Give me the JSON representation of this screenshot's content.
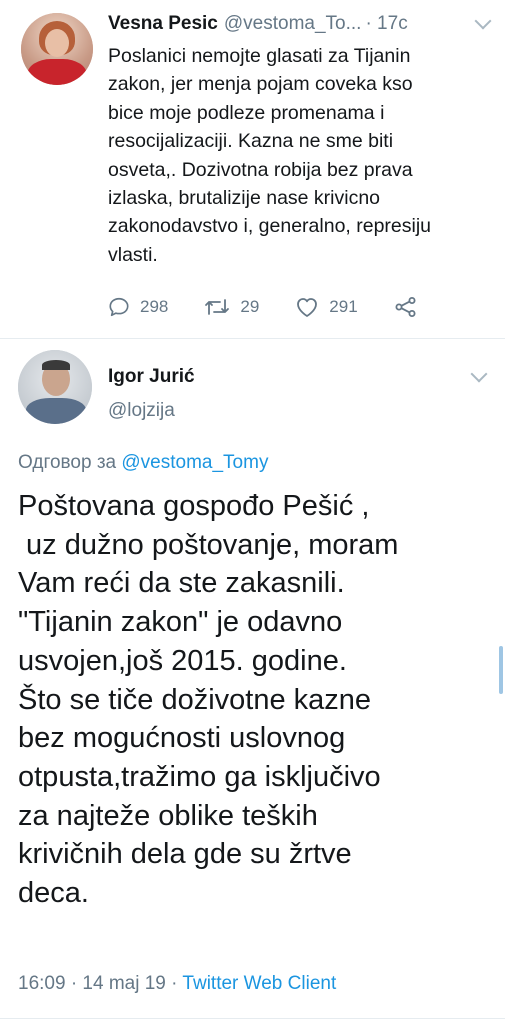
{
  "tweet1": {
    "name": "Vesna Pesic",
    "handle": "@vestoma_To...",
    "time": "· 17c",
    "lines": [
      "Poslanici nemojte glasati za Tijanin",
      "zakon, jer menja pojam coveka kso",
      "bice moje podleze promenama i",
      "resocijalizaciji. Kazna ne sme biti",
      "osveta,. Dozivotna robija bez prava",
      "izlaska, brutalizije nase krivicno",
      "zakonodavstvo i, generalno, represiju",
      "vlasti."
    ],
    "replies": "298",
    "retweets": "29",
    "likes": "291"
  },
  "tweet2": {
    "name": "Igor Jurić",
    "handle": "@lojzija",
    "reply_prefix": "Одговор за",
    "reply_mention": "@vestoma_Tomy",
    "lines": [
      "Poštovana gospođo Pešić ,",
      " uz dužno poštovanje, moram",
      "Vam reći da ste zakasnili.",
      "\"Tijanin zakon\" je odavno",
      "usvojen,još 2015. godine.",
      "Što se tiče doživotne kazne",
      "bez mogućnosti uslovnog",
      "otpusta,tražimo ga isključivo",
      "za najteže oblike teških",
      "krivičnih dela gde su žrtve",
      "deca."
    ],
    "time": "16:09",
    "date": "· 14 maj 19 ·",
    "client": "Twitter Web Client"
  },
  "icons": [
    "reply-icon",
    "retweet-icon",
    "like-icon",
    "share-icon",
    "chevron-down-icon"
  ],
  "colors": {
    "link": "#1b95e0",
    "secondary": "#657786",
    "text": "#14171a"
  }
}
